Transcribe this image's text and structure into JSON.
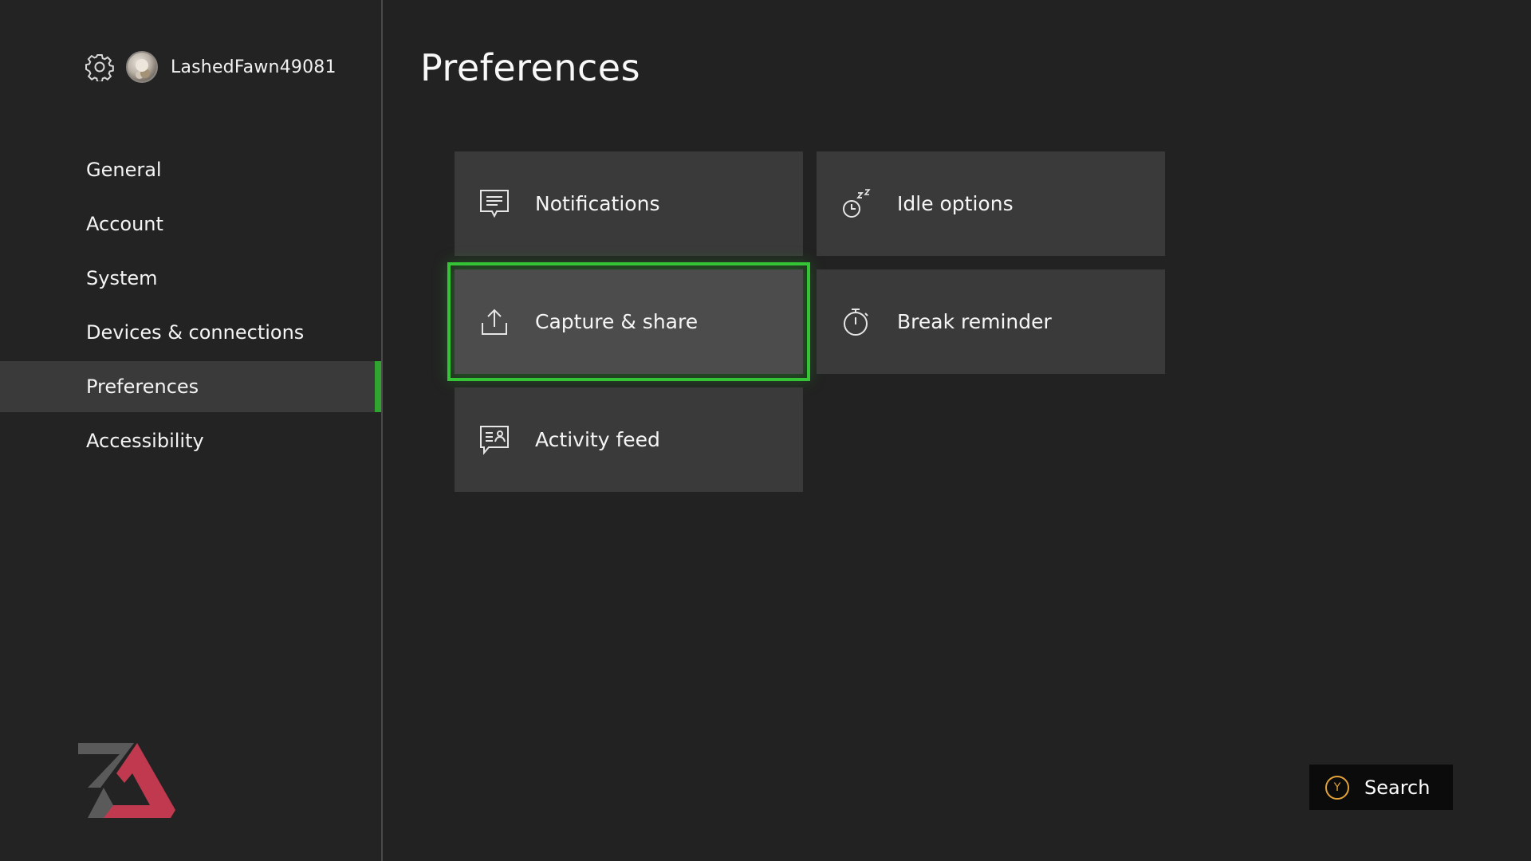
{
  "profile": {
    "gamertag": "LashedFawn49081",
    "settings_icon": "gear-icon",
    "avatar": "avatar"
  },
  "sidebar": {
    "items": [
      {
        "label": "General",
        "active": false
      },
      {
        "label": "Account",
        "active": false
      },
      {
        "label": "System",
        "active": false
      },
      {
        "label": "Devices & connections",
        "active": false
      },
      {
        "label": "Preferences",
        "active": true
      },
      {
        "label": "Accessibility",
        "active": false
      }
    ]
  },
  "main": {
    "title": "Preferences",
    "tiles": [
      {
        "label": "Notifications",
        "icon": "message-icon",
        "focused": false
      },
      {
        "label": "Idle options",
        "icon": "idle-timer-icon",
        "focused": false
      },
      {
        "label": "Capture & share",
        "icon": "upload-icon",
        "focused": true
      },
      {
        "label": "Break reminder",
        "icon": "stopwatch-icon",
        "focused": false
      },
      {
        "label": "Activity feed",
        "icon": "activity-feed-icon",
        "focused": false
      }
    ]
  },
  "footer": {
    "search_button_glyph": "Y",
    "search_label": "Search"
  },
  "colors": {
    "background": "#222222",
    "tile": "#3a3a3a",
    "tile_focused": "#4c4c4c",
    "accent_green": "#35c435",
    "y_button": "#e2a23a",
    "logo_gray": "#5a5a5a",
    "logo_red": "#c0394f"
  }
}
